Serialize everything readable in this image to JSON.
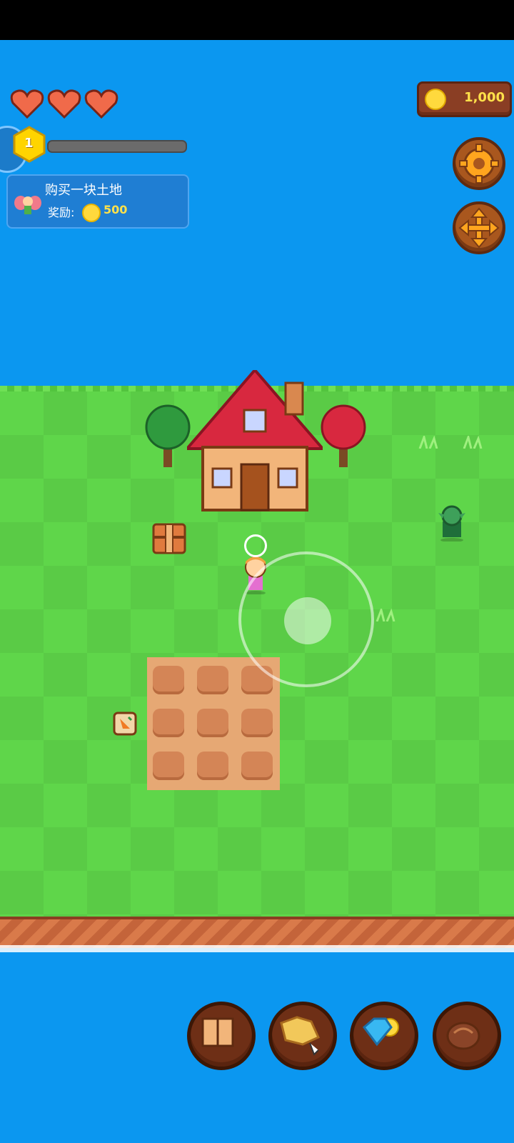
{
  "hud": {
    "hearts": [
      "heart",
      "heart",
      "heart"
    ],
    "level": "1",
    "xp_progress": 0,
    "coins": "1,000"
  },
  "quest": {
    "title": "购买一块土地",
    "reward_label": "奖励:",
    "reward_amount": "500"
  },
  "buttons": {
    "settings": "gear-icon",
    "move": "move-arrows-icon",
    "bottom": [
      "book-icon",
      "map-icon",
      "gem-coin-icon",
      "bag-icon"
    ]
  },
  "farm": {
    "plots": 9
  },
  "colors": {
    "sea": "#0b97f0",
    "grass": "#5fd64a",
    "coin": "#ffd93d",
    "button_wood": "#a9571e"
  }
}
